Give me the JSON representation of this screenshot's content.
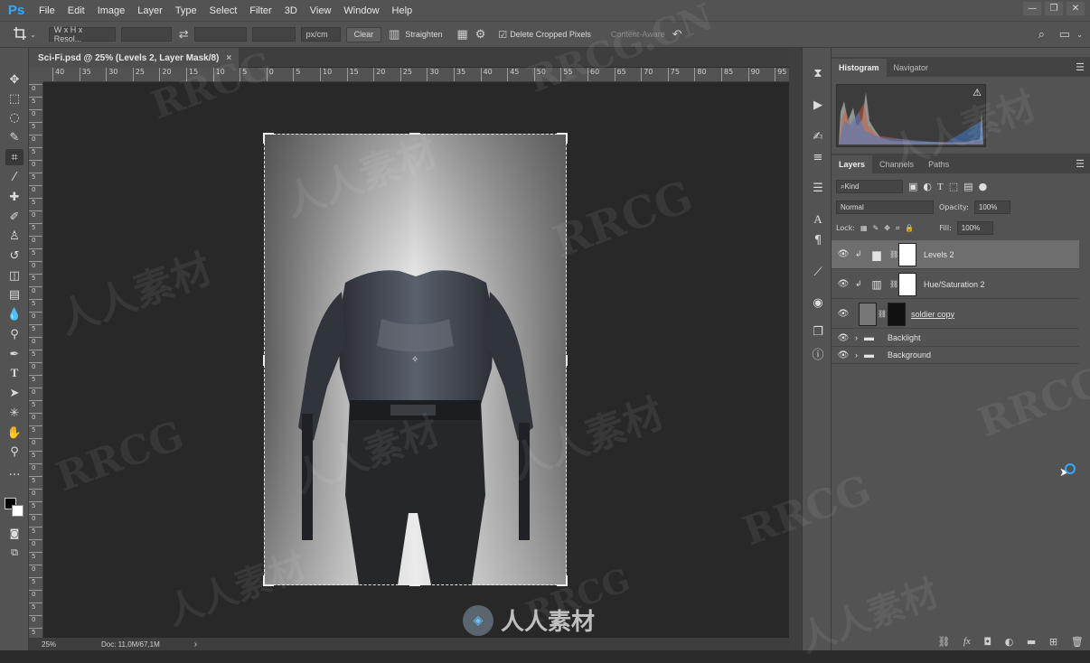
{
  "app": {
    "logo": "Ps"
  },
  "menu": [
    "File",
    "Edit",
    "Image",
    "Layer",
    "Type",
    "Select",
    "Filter",
    "3D",
    "View",
    "Window",
    "Help"
  ],
  "window_controls": [
    "—",
    "❐",
    "✕"
  ],
  "options_bar": {
    "ratio_select": "W x H x Resol...",
    "unit_select": "px/cm",
    "clear_label": "Clear",
    "straighten_label": "Straighten",
    "delete_cropped_label": "Delete Cropped Pixels",
    "delete_cropped_checked": true,
    "content_aware_label": "Content-Aware"
  },
  "document": {
    "tab_title": "Sci-Fi.psd @ 25% (Levels 2, Layer Mask/8)",
    "zoom": "25%",
    "doc_info": "Doc: 11,0M/67,1M"
  },
  "ruler": {
    "top": [
      "40",
      "35",
      "30",
      "25",
      "20",
      "15",
      "10",
      "5",
      "0",
      "5",
      "10",
      "15",
      "20",
      "25",
      "30",
      "35",
      "40",
      "45",
      "50",
      "55",
      "60",
      "65",
      "70",
      "75",
      "80",
      "85",
      "90",
      "95"
    ],
    "left": [
      "0",
      "5",
      "0",
      "5",
      "0",
      "5",
      "0",
      "5",
      "0",
      "5",
      "0",
      "5",
      "0",
      "5",
      "0",
      "5",
      "0",
      "5",
      "0",
      "5",
      "0",
      "5",
      "0",
      "5",
      "0",
      "5",
      "0",
      "5",
      "0",
      "5",
      "0",
      "5",
      "0",
      "5",
      "0",
      "5",
      "0",
      "5",
      "0",
      "5",
      "0",
      "5",
      "0",
      "5"
    ]
  },
  "panels": {
    "histogram_tabs": [
      "Histogram",
      "Navigator"
    ],
    "layer_tabs": [
      "Layers",
      "Channels",
      "Paths"
    ],
    "filter_kind": "Kind",
    "blend_mode": "Normal",
    "opacity_label": "Opacity:",
    "opacity": "100%",
    "lock_label": "Lock:",
    "fill_label": "Fill:",
    "fill": "100%"
  },
  "layers": [
    {
      "name": "Levels 2",
      "type": "adjustment-levels",
      "selected": true
    },
    {
      "name": "Hue/Saturation 2",
      "type": "adjustment-hue",
      "selected": false
    },
    {
      "name": "soldier copy",
      "type": "image",
      "selected": false
    },
    {
      "name": "Backlight",
      "type": "group",
      "selected": false
    },
    {
      "name": "Background",
      "type": "group",
      "selected": false
    }
  ],
  "watermarks": [
    "RRCG",
    "人人素材",
    "RRCG.CN",
    "RRCG",
    "人人素材",
    "RRCG",
    "人人素材",
    "RRCG",
    "人人素材",
    "RRCG",
    "人人素材",
    "人人素材",
    "RRCG",
    "人人素材"
  ],
  "bottom_logo": "人人素材",
  "colors": {
    "accent": "#31a8ff",
    "panel": "#535353",
    "canvas": "#282828"
  }
}
